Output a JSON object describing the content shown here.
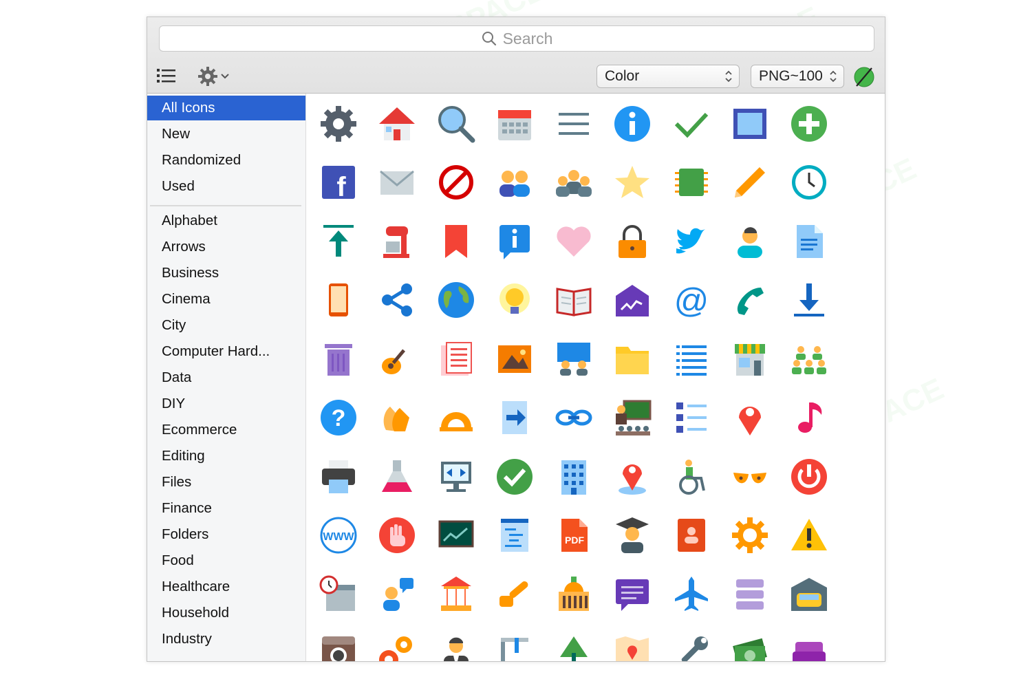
{
  "search": {
    "placeholder": "Search"
  },
  "toolbar": {
    "list_icon": "list-icon",
    "gear_icon": "gear-icon",
    "color_select": {
      "value": "Color"
    },
    "format_select": {
      "value": "PNG~100"
    },
    "background_swatch": "no-color-icon"
  },
  "watermark": "AI TALENT SPACE",
  "sidebar": {
    "items": [
      {
        "label": "All Icons",
        "selected": true
      },
      {
        "label": "New"
      },
      {
        "label": "Randomized"
      },
      {
        "label": "Used"
      },
      {
        "label": "Alphabet"
      },
      {
        "label": "Arrows"
      },
      {
        "label": "Business"
      },
      {
        "label": "Cinema"
      },
      {
        "label": "City"
      },
      {
        "label": "Computer Hard..."
      },
      {
        "label": "Data"
      },
      {
        "label": "DIY"
      },
      {
        "label": "Ecommerce"
      },
      {
        "label": "Editing"
      },
      {
        "label": "Files"
      },
      {
        "label": "Finance"
      },
      {
        "label": "Folders"
      },
      {
        "label": "Food"
      },
      {
        "label": "Healthcare"
      },
      {
        "label": "Household"
      },
      {
        "label": "Industry"
      }
    ]
  },
  "icons": [
    [
      "settings",
      "home",
      "search",
      "calendar",
      "menu",
      "info",
      "checkmark",
      "picture-frame",
      "plus"
    ],
    [
      "facebook",
      "mail",
      "cancel",
      "user-group",
      "conference",
      "star",
      "processor",
      "pencil",
      "clock"
    ],
    [
      "upload",
      "stand-mixer",
      "bookmark",
      "info-bubble",
      "heart",
      "lock",
      "twitter",
      "user",
      "document"
    ],
    [
      "smartphone",
      "share",
      "globe",
      "idea",
      "book",
      "envelope-signature",
      "at-sign",
      "phone",
      "download"
    ],
    [
      "trash",
      "guitar",
      "news",
      "image",
      "collaboration",
      "folder",
      "list",
      "shop",
      "team"
    ],
    [
      "help",
      "clapping",
      "protractor",
      "right-arrow",
      "link",
      "classroom",
      "checklist",
      "marker",
      "music"
    ],
    [
      "printer",
      "flask",
      "remote-desktop",
      "ok",
      "office-building",
      "map-pin",
      "wheelchair",
      "bra",
      "power"
    ],
    [
      "www",
      "hand-stop",
      "chalkboard",
      "code-document",
      "pdf",
      "graduate",
      "address-book",
      "gear-orange",
      "warning"
    ],
    [
      "calendar-clock",
      "chat-user",
      "carousel",
      "chainsaw",
      "town-hall",
      "chat",
      "airplane",
      "database",
      "garage"
    ],
    [
      "instagram",
      "gears",
      "businessman",
      "caliper",
      "tree",
      "map",
      "wrench",
      "money",
      "sofa"
    ]
  ]
}
